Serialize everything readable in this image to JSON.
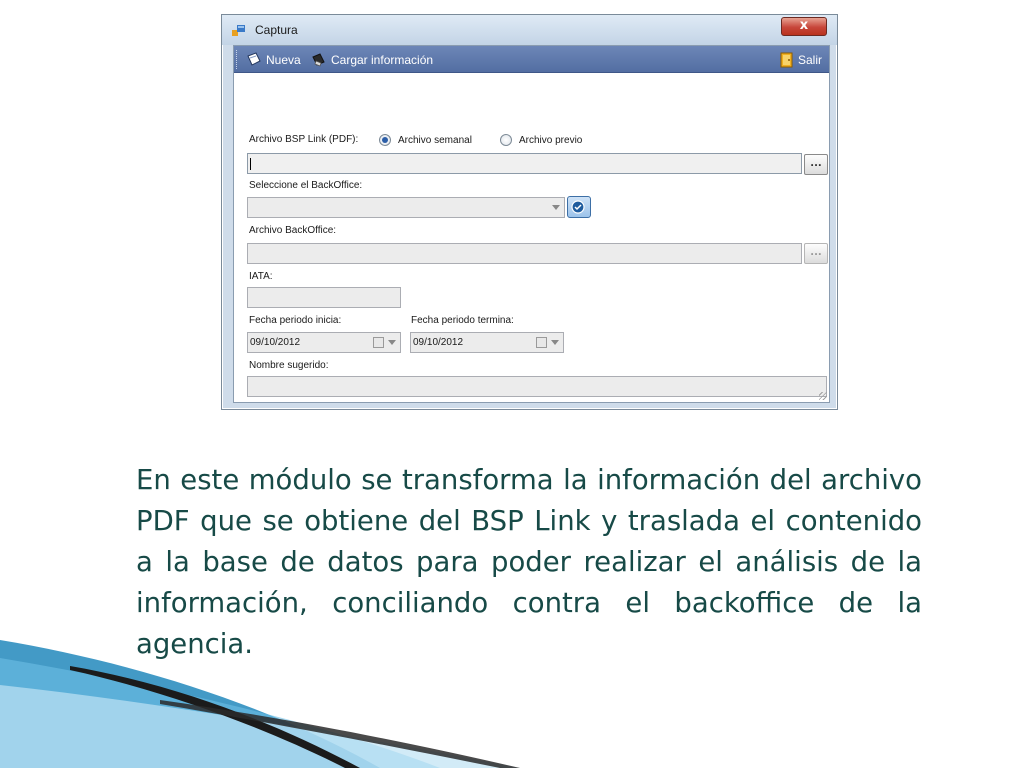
{
  "window": {
    "title": "Captura",
    "close_label": "x"
  },
  "toolbar": {
    "new_label": "Nueva",
    "load_label": "Cargar información",
    "exit_label": "Salir"
  },
  "form": {
    "bsp_label": "Archivo BSP Link (PDF):",
    "radio_weekly": "Archivo semanal",
    "radio_previous": "Archivo previo",
    "selected_radio": "Archivo semanal",
    "browse_label": "...",
    "backoffice_select_label": "Seleccione el BackOffice:",
    "backoffice_file_label": "Archivo BackOffice:",
    "iata_label": "IATA:",
    "date_start_label": "Fecha periodo inicia:",
    "date_end_label": "Fecha periodo termina:",
    "date_start_value": "09/10/2012",
    "date_end_value": "09/10/2012",
    "suggested_name_label": "Nombre sugerido:"
  },
  "description": "En este módulo se transforma la información del archivo PDF que se obtiene del BSP Link y traslada el contenido a la base de datos para poder realizar el análisis de la información, conciliando contra el backoffice de la agencia.",
  "colors": {
    "toolbar": "#5b74a8",
    "text_teal": "#174a47",
    "swoosh_blue": "#2f8fc0",
    "swoosh_dark": "#1b1b1b"
  }
}
